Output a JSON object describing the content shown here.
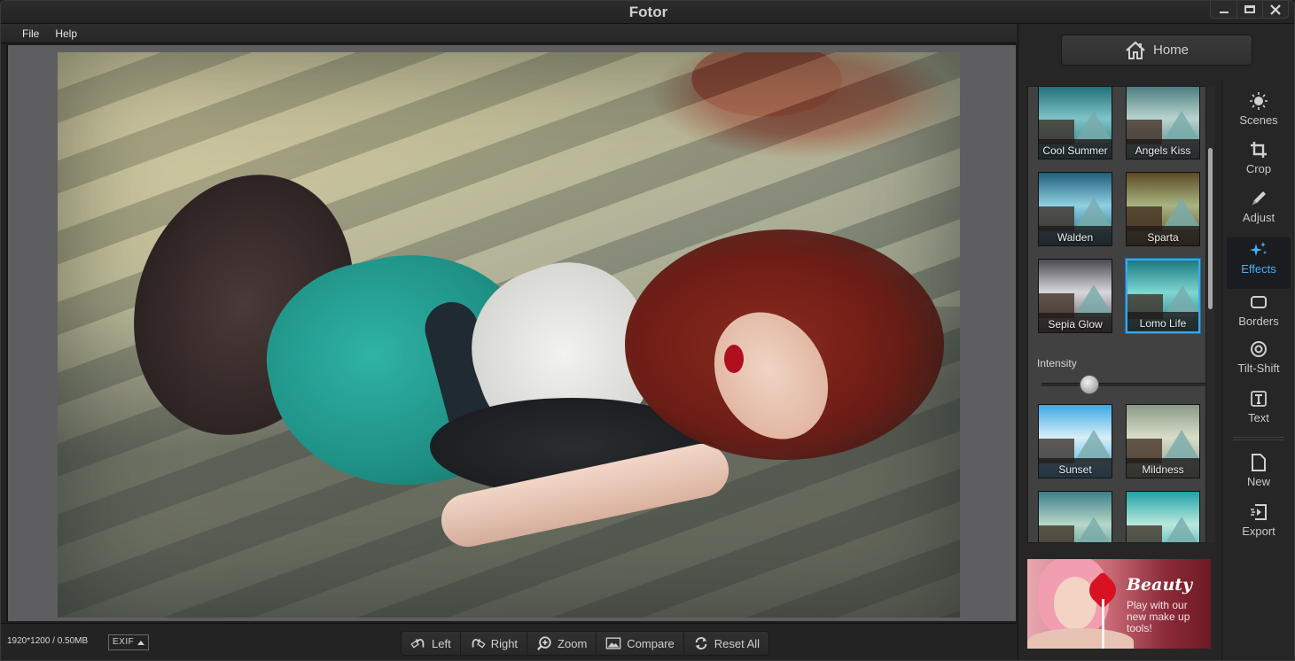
{
  "window": {
    "title": "Fotor",
    "controls": {
      "minimize": "minimize-icon",
      "maximize": "maximize-icon",
      "close": "close-icon"
    }
  },
  "menu": {
    "items": [
      {
        "label": "File"
      },
      {
        "label": "Help"
      }
    ]
  },
  "status": {
    "dimensions": "1920*1200 / 0.50MB",
    "exif_label": "EXIF"
  },
  "toolbar": {
    "buttons": [
      {
        "label": "Left",
        "icon": "rotate-left-icon"
      },
      {
        "label": "Right",
        "icon": "rotate-right-icon"
      },
      {
        "label": "Zoom",
        "icon": "zoom-in-icon"
      },
      {
        "label": "Compare",
        "icon": "compare-image-icon"
      },
      {
        "label": "Reset All",
        "icon": "reset-icon"
      }
    ]
  },
  "right_panel": {
    "home_label": "Home",
    "effects": [
      {
        "label": "Cool Summer",
        "colors": [
          "#1e6f78",
          "#7fc4c8"
        ]
      },
      {
        "label": "Angels Kiss",
        "colors": [
          "#4a7b7e",
          "#b9d4cf"
        ]
      },
      {
        "label": "Walden",
        "colors": [
          "#215e7a",
          "#8ed0e2"
        ]
      },
      {
        "label": "Sparta",
        "colors": [
          "#5c4a25",
          "#a8b480"
        ]
      },
      {
        "label": "Sepia Glow",
        "colors": [
          "#4a4850",
          "#d8d8dc"
        ]
      },
      {
        "label": "Lomo Life",
        "colors": [
          "#1a7b80",
          "#7fd6d2"
        ],
        "selected": true
      },
      {
        "label": "Sunset",
        "colors": [
          "#3aa8e6",
          "#d8eef8"
        ]
      },
      {
        "label": "Mildness",
        "colors": [
          "#8a9a88",
          "#d9ddc8"
        ]
      },
      {
        "label": "",
        "colors": [
          "#3c7f8a",
          "#b6d8c8"
        ]
      },
      {
        "label": "",
        "colors": [
          "#21a2a8",
          "#b8e8dc"
        ]
      }
    ],
    "intensity": {
      "label": "Intensity",
      "value": 0.29
    },
    "ad": {
      "title": "Beauty",
      "text": "Play with our new make up tools!"
    }
  },
  "tools": [
    {
      "label": "Scenes",
      "icon": "sun-icon"
    },
    {
      "label": "Crop",
      "icon": "crop-icon"
    },
    {
      "label": "Adjust",
      "icon": "pencil-icon"
    },
    {
      "label": "Effects",
      "icon": "sparkles-icon",
      "active": true
    },
    {
      "label": "Borders",
      "icon": "border-frame-icon"
    },
    {
      "label": "Tilt-Shift",
      "icon": "tilt-shift-icon"
    },
    {
      "label": "Text",
      "icon": "text-icon"
    },
    {
      "label": "New",
      "icon": "new-file-icon"
    },
    {
      "label": "Export",
      "icon": "export-icon"
    }
  ],
  "colors": {
    "accent": "#3aa6f0",
    "active_tool_text": "#4aaef0",
    "panel_bg": "#262626",
    "canvas_bg": "#5e5e60"
  }
}
